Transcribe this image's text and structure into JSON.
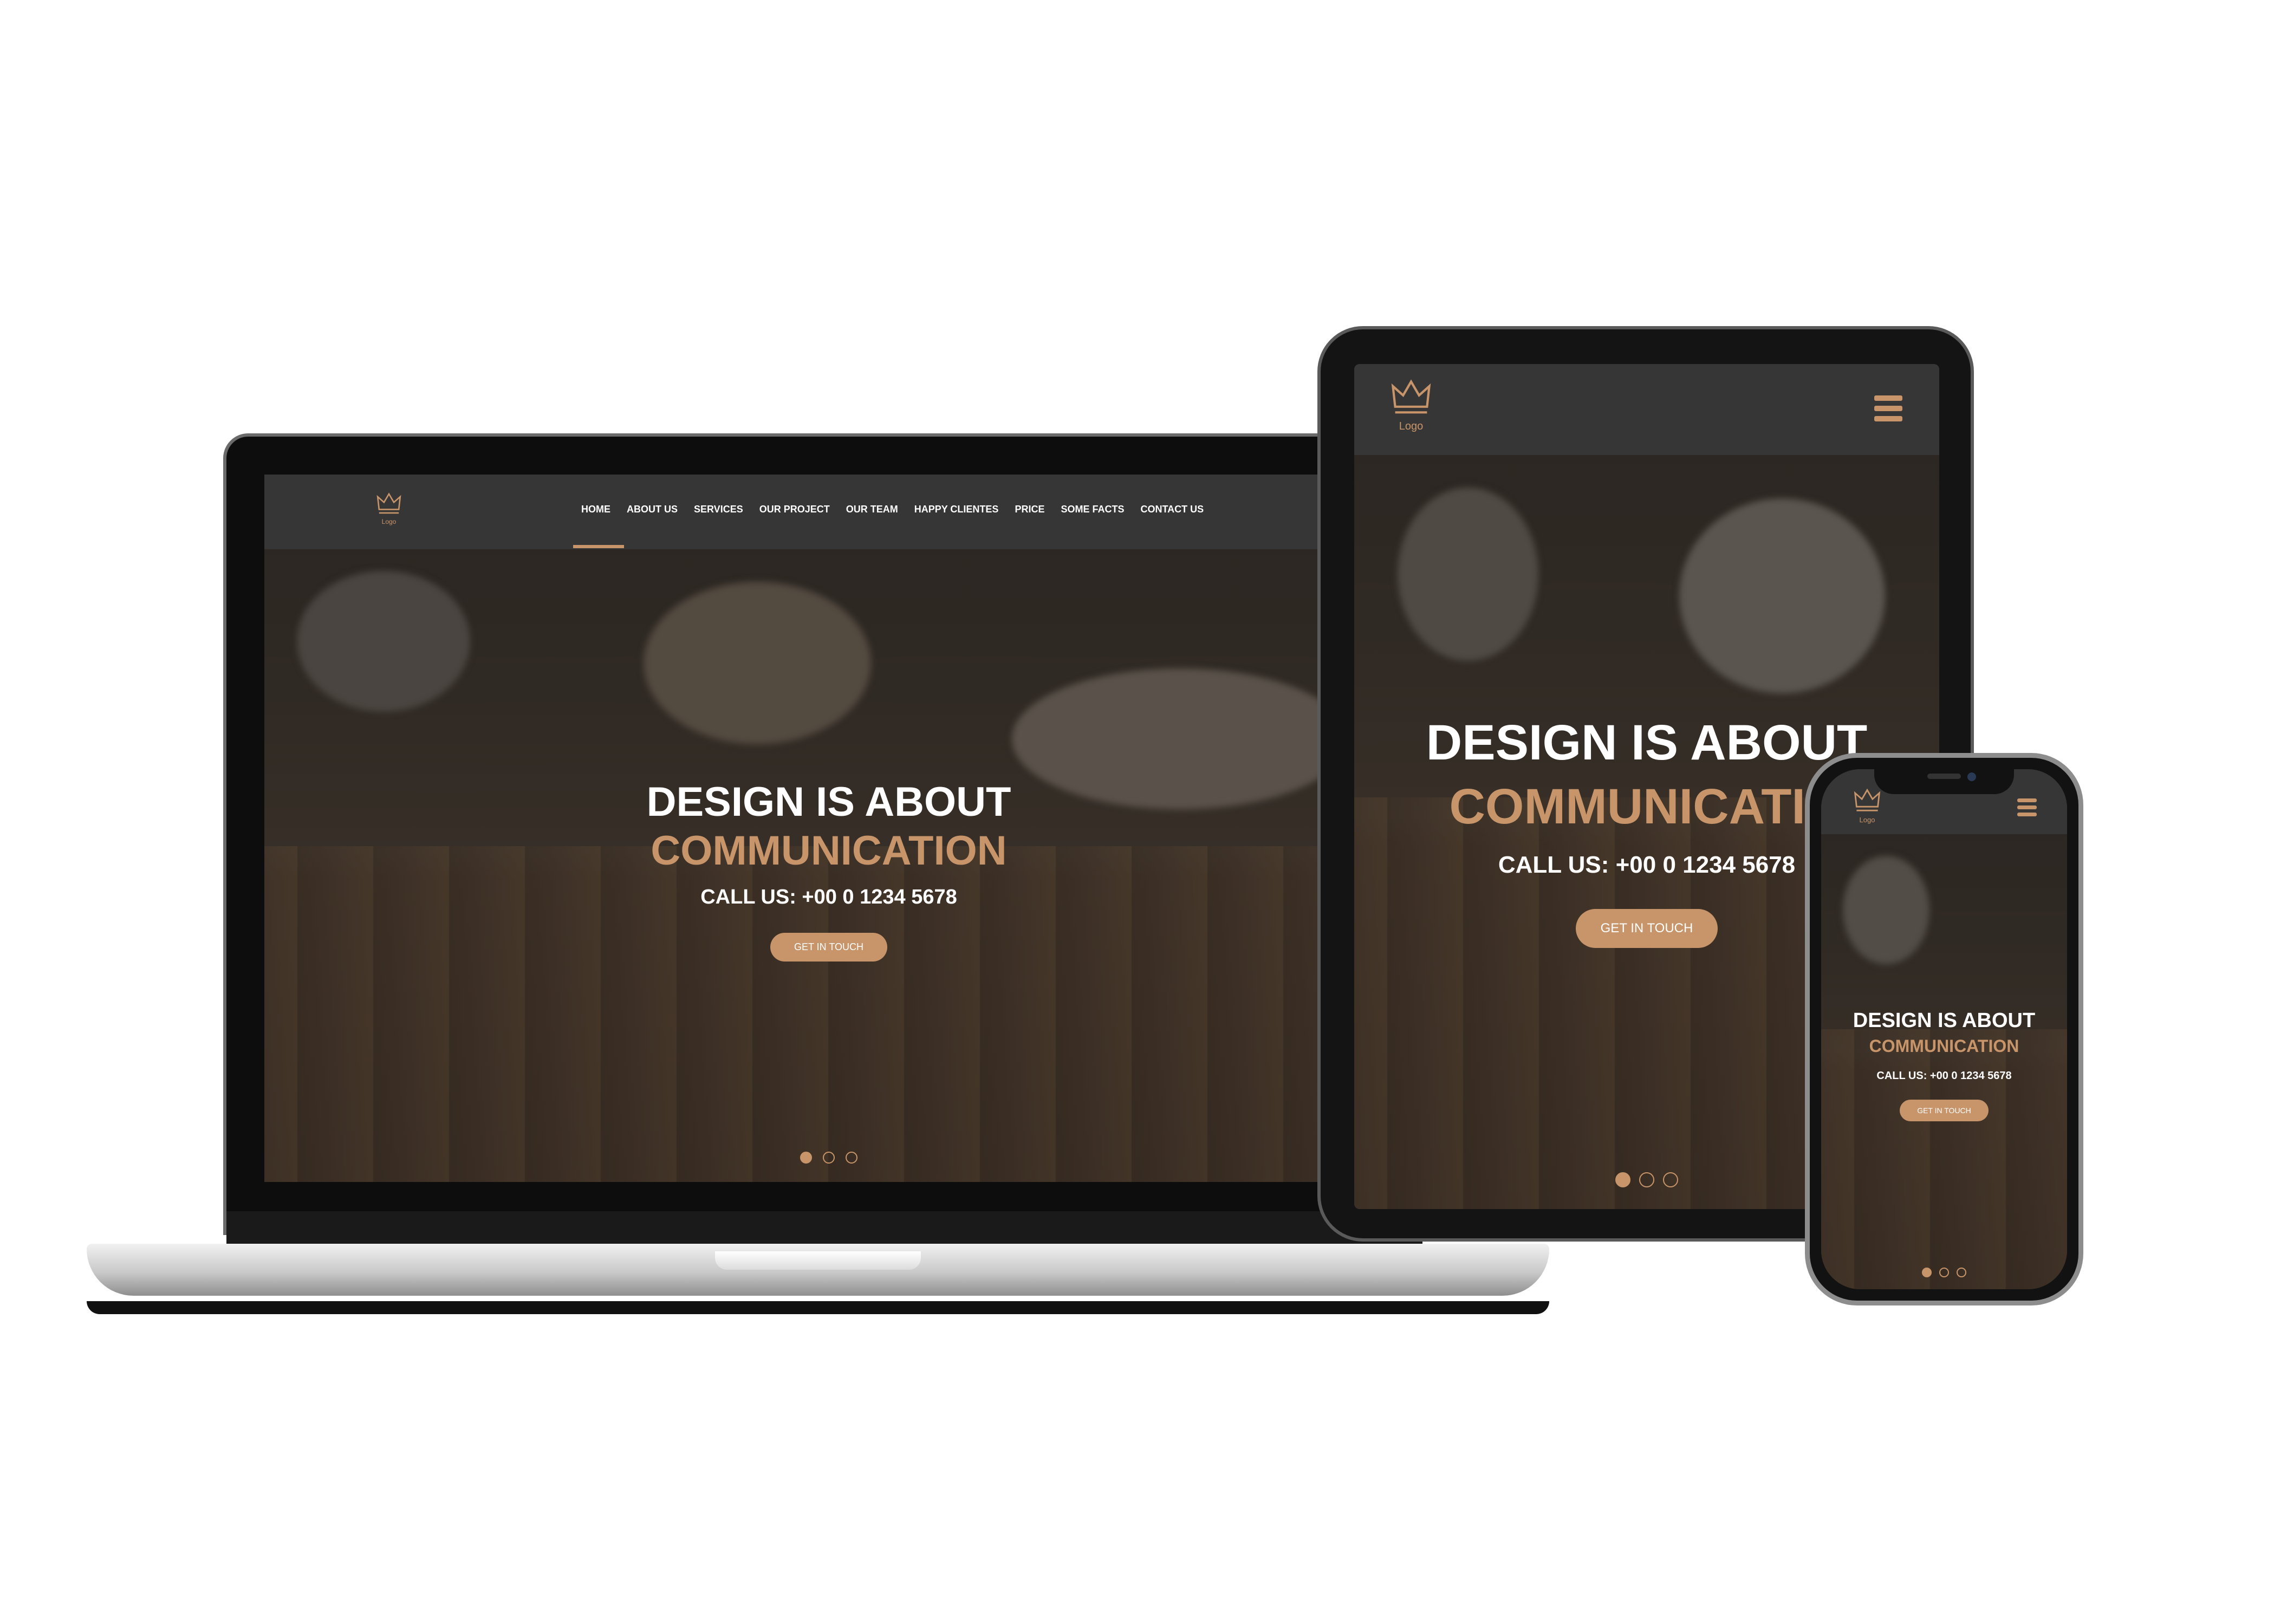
{
  "brand": {
    "logo_text": "Logo"
  },
  "colors": {
    "accent": "#c8956a",
    "header": "#363636",
    "text": "#ffffff"
  },
  "nav": {
    "items": [
      {
        "label": "HOME",
        "active": true
      },
      {
        "label": "ABOUT US"
      },
      {
        "label": "SERVICES"
      },
      {
        "label": "OUR PROJECT"
      },
      {
        "label": "OUR TEAM"
      },
      {
        "label": "HAPPY CLIENTES"
      },
      {
        "label": "PRICE"
      },
      {
        "label": "SOME FACTS"
      },
      {
        "label": "CONTACT US"
      }
    ],
    "menu_icon": "hamburger-icon"
  },
  "hero": {
    "line1": "DESIGN IS ABOUT",
    "line2": "COMMUNICATION",
    "line2_tablet": "COMMUNICATIO",
    "call": "CALL US: +00 0 1234 5678",
    "cta": "GET IN TOUCH"
  },
  "slider": {
    "count": 3,
    "active_index": 0
  },
  "icons": {
    "logo": "crown-icon",
    "menu": "hamburger-icon"
  }
}
